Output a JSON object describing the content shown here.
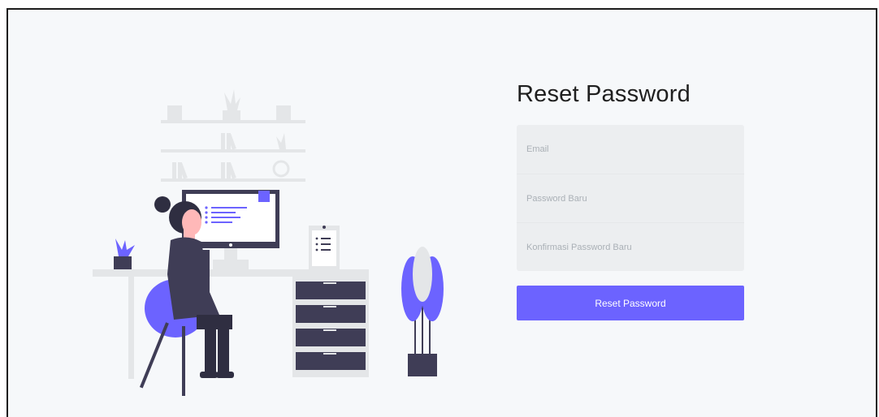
{
  "page": {
    "title": "Reset Password"
  },
  "form": {
    "email_placeholder": "Email",
    "new_password_placeholder": "Password Baru",
    "confirm_password_placeholder": "Konfirmasi Password Baru",
    "submit_label": "Reset Password"
  },
  "illustration": {
    "subject": "person-working-at-desk-illustration"
  },
  "colors": {
    "accent": "#6c63ff",
    "background": "#f6f8fa",
    "field_background": "#eceef0",
    "dark": "#3f3d56"
  }
}
